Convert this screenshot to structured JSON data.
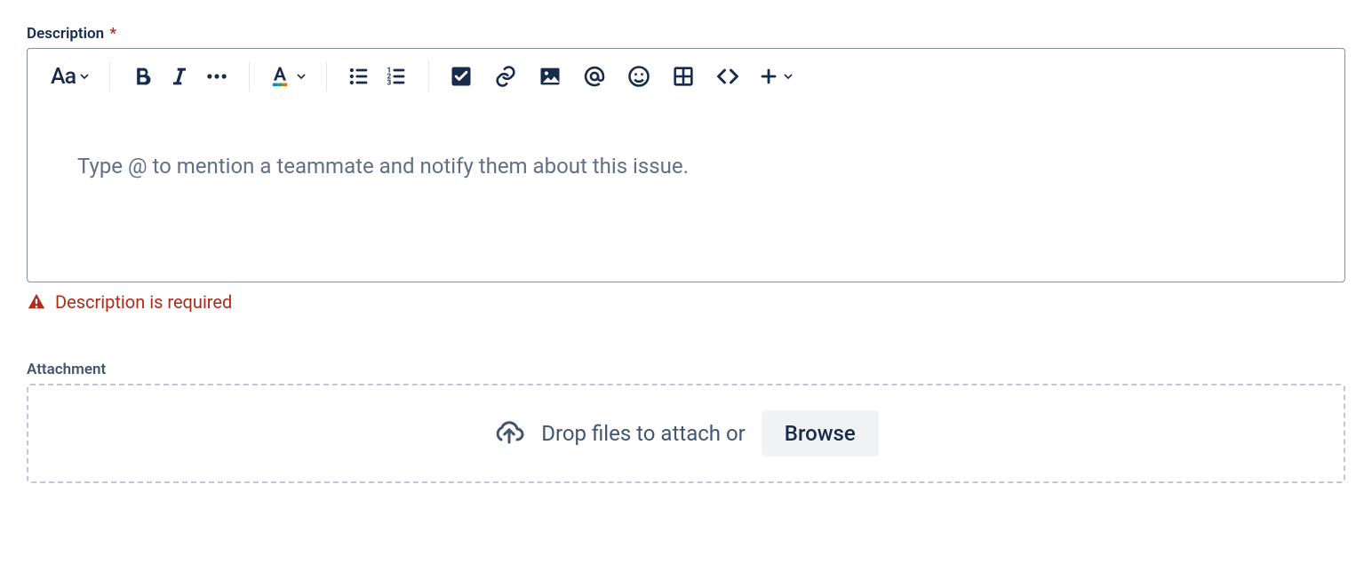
{
  "description": {
    "label": "Description",
    "required_marker": "*",
    "placeholder": "Type @ to mention a teammate and notify them about this issue.",
    "error_message": "Description is required"
  },
  "toolbar": {
    "text_style_label": "Aa",
    "icons": {
      "text_style": "text-style",
      "bold": "bold",
      "italic": "italic",
      "more": "more-formatting",
      "text_color": "text-color",
      "bullet_list": "bullet-list",
      "numbered_list": "numbered-list",
      "checkbox": "action-item",
      "link": "link",
      "image": "image",
      "mention": "mention",
      "emoji": "emoji",
      "table": "table",
      "code": "code-snippet",
      "plus": "insert"
    }
  },
  "attachment": {
    "label": "Attachment",
    "dropzone_text": "Drop files to attach or",
    "browse_label": "Browse"
  }
}
